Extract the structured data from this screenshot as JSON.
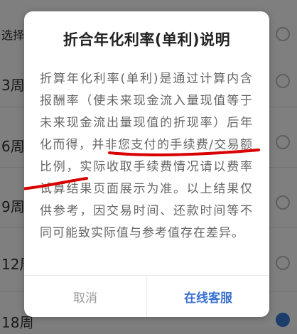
{
  "background": {
    "top_label": "选择",
    "rows": [
      {
        "label": "3周"
      },
      {
        "label": "6周"
      },
      {
        "label": "9周"
      },
      {
        "label": "12周"
      },
      {
        "label": "18周"
      }
    ]
  },
  "dialog": {
    "title": "折合年化利率(单利)说明",
    "body": "折算年化利率(单利)是通过计算内含报酬率（使未来现金流入量现值等于未来现金流出量现值的折现率）后年化而得，并非您支付的手续费/交易额比例，实际收取手续费情况请以费率试算结果页面展示为准。以上结果仅供参考，因交易时间、还款时间等不同可能致实际值与参考值存在差异。",
    "cancel_label": "取消",
    "service_label": "在线客服"
  },
  "colors": {
    "annotation": "#d90000",
    "accent": "#3b72d0"
  }
}
